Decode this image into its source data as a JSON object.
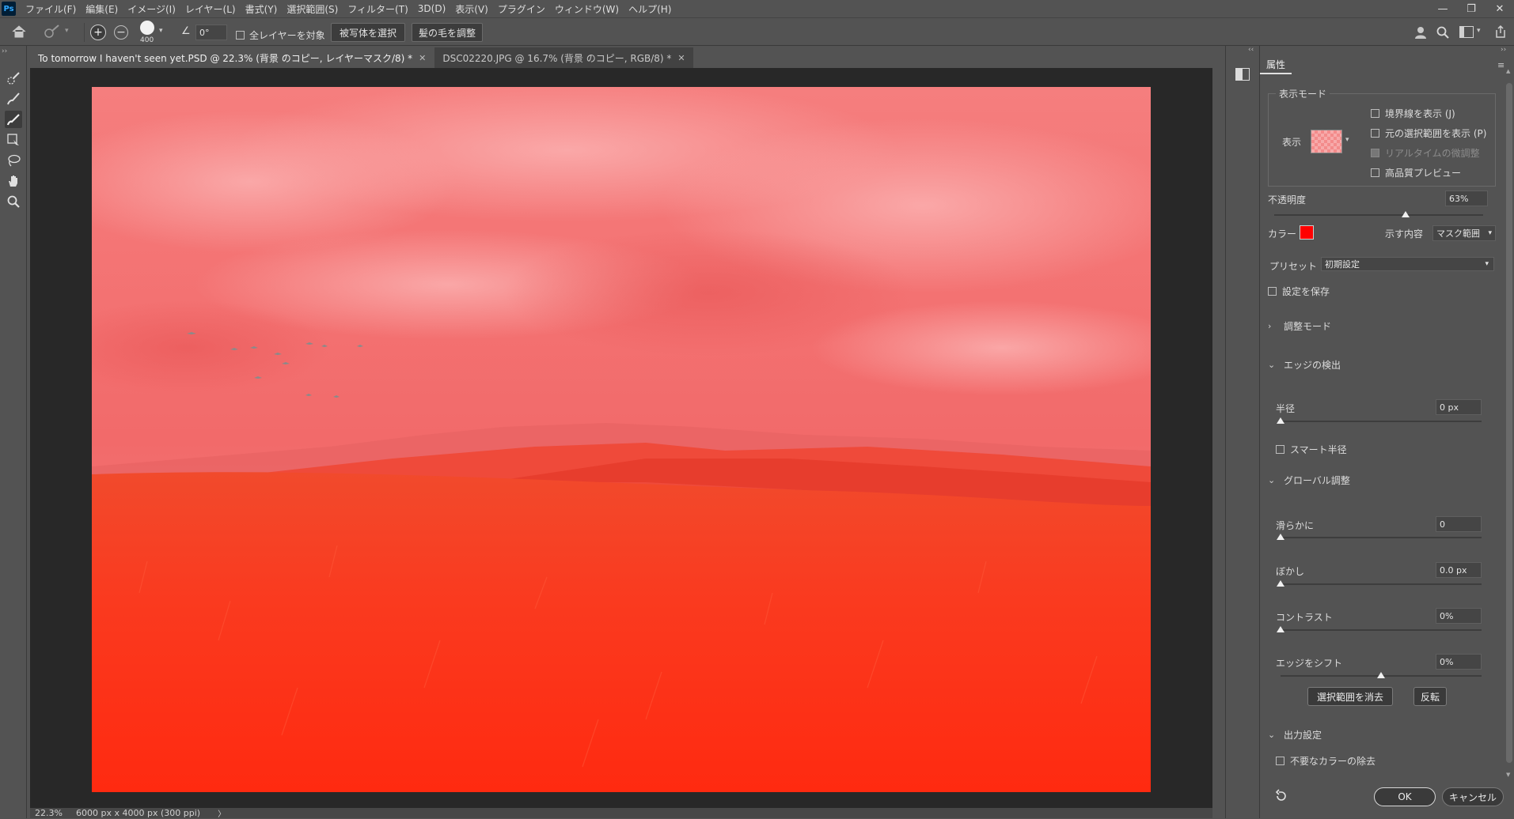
{
  "app": {
    "logo": "Ps"
  },
  "menu": [
    "ファイル(F)",
    "編集(E)",
    "イメージ(I)",
    "レイヤー(L)",
    "書式(Y)",
    "選択範囲(S)",
    "フィルター(T)",
    "3D(D)",
    "表示(V)",
    "プラグイン",
    "ウィンドウ(W)",
    "ヘルプ(H)"
  ],
  "window_controls": {
    "minimize": "—",
    "restore": "❐",
    "close": "✕"
  },
  "options": {
    "brush_size": "400",
    "angle": "0°",
    "all_layers_label": "全レイヤーを対象",
    "select_subject": "被写体を選択",
    "refine_hair": "髪の毛を調整"
  },
  "tabs": [
    {
      "label": "To tomorrow I haven't seen yet.PSD @ 22.3% (背景 のコピー, レイヤーマスク/8) *",
      "active": true
    },
    {
      "label": "DSC02220.JPG @ 16.7% (背景 のコピー, RGB/8) *",
      "active": false
    }
  ],
  "status": {
    "zoom": "22.3%",
    "doc_info": "6000 px x 4000 px (300 ppi)",
    "arrow": "〉"
  },
  "panel": {
    "tab_label": "属性",
    "view_mode": {
      "group_label": "表示モード",
      "view_label": "表示",
      "show_edge": "境界線を表示 (J)",
      "show_original": "元の選択範囲を表示 (P)",
      "realtime": "リアルタイムの微調整",
      "hq_preview": "高品質プレビュー"
    },
    "opacity": {
      "label": "不透明度",
      "value": "63%",
      "level": 0.63
    },
    "color": {
      "label": "カラー",
      "swatch": "#ff0000",
      "indicates_label": "示す内容",
      "indicates_value": "マスク範囲"
    },
    "preset": {
      "label": "プリセット",
      "value": "初期設定"
    },
    "remember": "設定を保存",
    "refine_mode": "調整モード",
    "edge_detection": {
      "header": "エッジの検出",
      "radius_label": "半径",
      "radius_value": "0 px",
      "smart_radius": "スマート半径"
    },
    "global": {
      "header": "グローバル調整",
      "smooth_label": "滑らかに",
      "smooth_value": "0",
      "feather_label": "ぼかし",
      "feather_value": "0.0 px",
      "contrast_label": "コントラスト",
      "contrast_value": "0%",
      "shift_label": "エッジをシフト",
      "shift_value": "0%",
      "clear_button": "選択範囲を消去",
      "invert_button": "反転"
    },
    "output": {
      "header": "出力設定",
      "decontaminate": "不要なカラーの除去"
    },
    "ok": "OK",
    "cancel": "キャンセル"
  }
}
